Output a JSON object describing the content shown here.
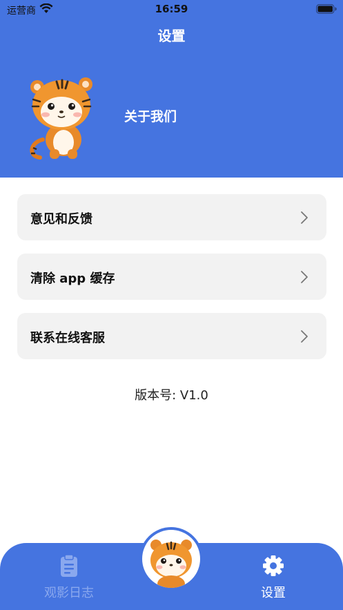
{
  "status_bar": {
    "carrier": "运营商",
    "time": "16:59"
  },
  "nav": {
    "title": "设置"
  },
  "profile": {
    "about_label": "关于我们",
    "avatar_icon": "tiger-mascot"
  },
  "menu": [
    {
      "label": "意见和反馈",
      "icon": "chevron-right-icon"
    },
    {
      "label": "清除 app 缓存",
      "icon": "chevron-right-icon"
    },
    {
      "label": "联系在线客服",
      "icon": "chevron-right-icon"
    }
  ],
  "version": {
    "text": "版本号: V1.0"
  },
  "tabbar": {
    "tabs": [
      {
        "label": "观影日志",
        "icon": "clipboard-icon",
        "active": false
      },
      {
        "label": "设置",
        "icon": "gear-icon",
        "active": true
      }
    ],
    "center_icon": "tiger-mascot"
  },
  "colors": {
    "primary": "#4574e0",
    "card_bg": "#f2f2f2",
    "inactive_tab": "#8aa8ee"
  }
}
